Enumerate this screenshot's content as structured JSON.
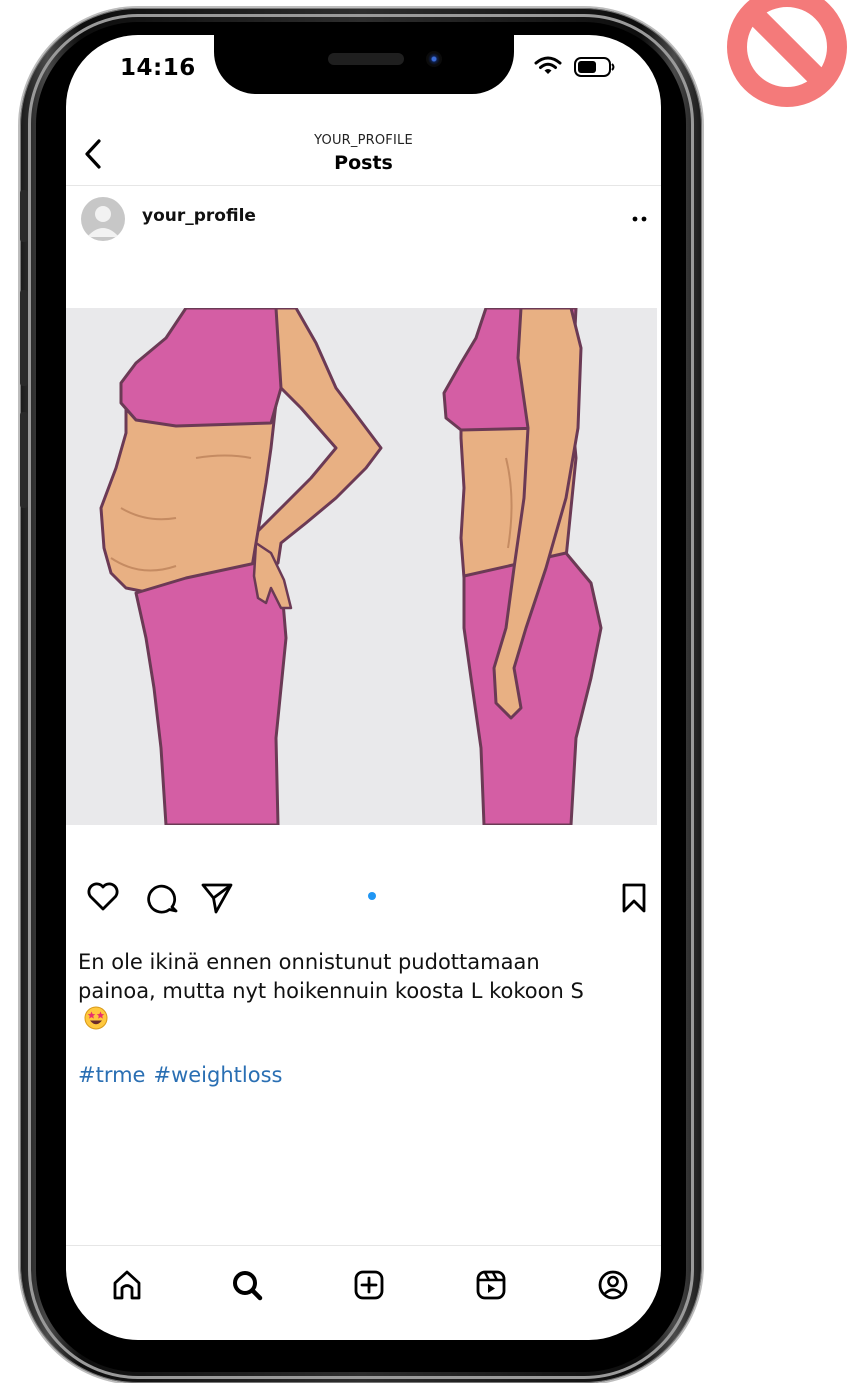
{
  "status_bar": {
    "time": "14:16"
  },
  "header": {
    "profile": "YOUR_PROFILE",
    "title": "Posts"
  },
  "post": {
    "username": "your_profile",
    "caption": "En ole ikinä ennen onnistunut pudottamaan painoa, mutta nyt hoikennuin koosta L kokoon S",
    "hashtags": [
      "#trme",
      "#weightloss"
    ]
  },
  "nav": {
    "items": [
      "home-icon",
      "search-icon",
      "create-icon",
      "reels-icon",
      "profile-icon"
    ]
  },
  "colors": {
    "link": "#2a6fb3",
    "dot": "#2196f3",
    "no_sign": "#f47a7a",
    "body_pink": "#d45ea4",
    "skin": "#e8b083"
  }
}
